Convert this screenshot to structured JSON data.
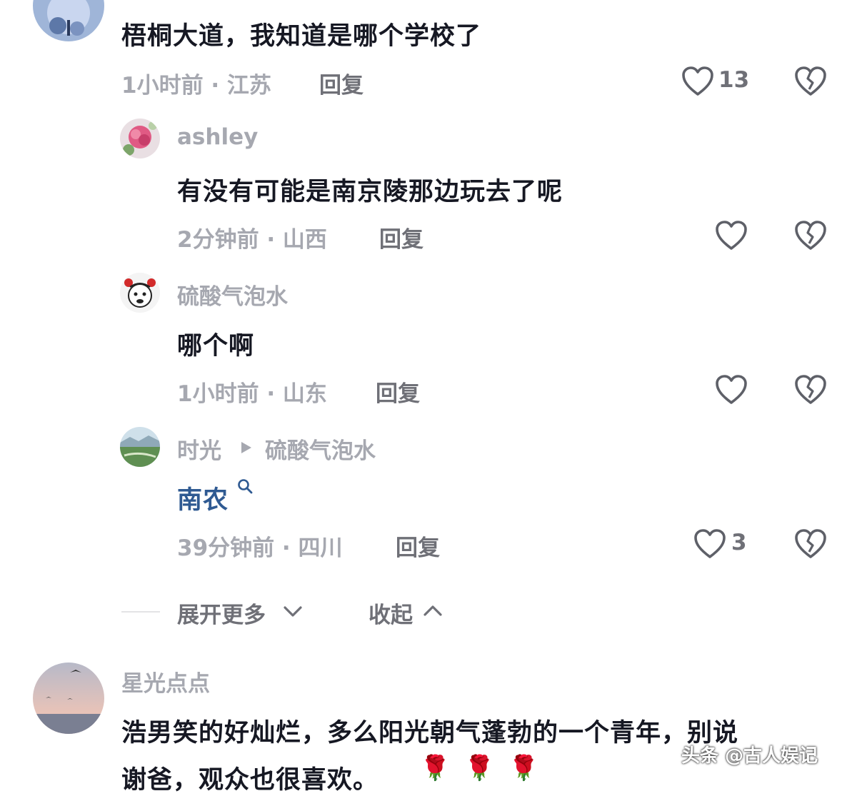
{
  "comments": [
    {
      "text": "梧桐大道，我知道是哪个学校了",
      "meta": "1小时前 · 江苏",
      "reply": "回复",
      "likes": "13",
      "avatar_icon": "jellyfish-avatar"
    }
  ],
  "replies": [
    {
      "user": "ashley",
      "text": "有没有可能是南京陵那边玩去了呢",
      "meta": "2分钟前 · 山西",
      "reply": "回复",
      "likes": "",
      "avatar_icon": "flower-avatar"
    },
    {
      "user": "硫酸气泡水",
      "text": "哪个啊",
      "meta": "1小时前 · 山东",
      "reply": "回复",
      "likes": "",
      "avatar_icon": "cartoon-avatar"
    },
    {
      "user": "时光",
      "reply_to": "硫酸气泡水",
      "text": "南农",
      "meta": "39分钟前 · 四川",
      "reply": "回复",
      "likes": "3",
      "avatar_icon": "landscape-avatar"
    }
  ],
  "thread_controls": {
    "expand_more": "展开更多",
    "collapse": "收起"
  },
  "next_comment": {
    "user": "星光点点",
    "text_line1": "浩男笑的好灿烂，多么阳光朝气蓬勃的一个青年，别说",
    "text_line2": "谢爸，观众也很喜欢。",
    "emoji": "🌹",
    "avatar_icon": "sunset-avatar"
  },
  "watermark": "头条 @古人娱记",
  "colors": {
    "text": "#161823",
    "meta": "#a6a8b0",
    "reply": "#6f7077",
    "link": "#2f5a92"
  }
}
